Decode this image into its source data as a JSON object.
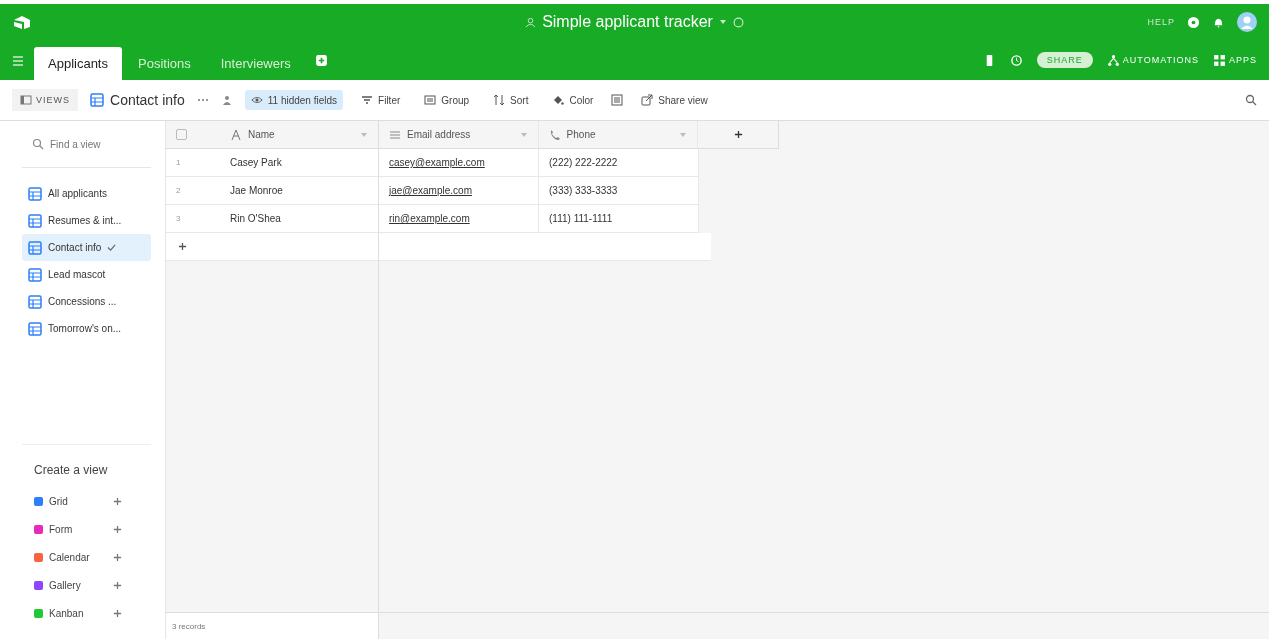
{
  "header": {
    "title": "Simple applicant tracker",
    "help": "HELP"
  },
  "tabs": [
    {
      "label": "Applicants",
      "selected": true
    },
    {
      "label": "Positions",
      "selected": false
    },
    {
      "label": "Interviewers",
      "selected": false
    }
  ],
  "base_actions": {
    "share": "SHARE",
    "automations": "AUTOMATIONS",
    "apps": "APPS"
  },
  "toolbar": {
    "views": "VIEWS",
    "current_view": "Contact info",
    "hidden_fields": "11 hidden fields",
    "filter": "Filter",
    "group": "Group",
    "sort": "Sort",
    "color_label": "Color",
    "share_view": "Share view"
  },
  "sidebar": {
    "search": {
      "placeholder": "Find a view"
    },
    "items": [
      {
        "label": "All applicants",
        "selected": false
      },
      {
        "label": "Resumes & int...",
        "selected": false
      },
      {
        "label": "Contact info",
        "selected": true
      },
      {
        "label": "Lead mascot",
        "selected": false
      },
      {
        "label": "Concessions ...",
        "selected": false
      },
      {
        "label": "Tomorrow's on...",
        "selected": false
      }
    ],
    "create_title": "Create a view",
    "create_items": [
      {
        "label": "Grid",
        "color": "#2d7ff9"
      },
      {
        "label": "Form",
        "color": "#e929ba"
      },
      {
        "label": "Calendar",
        "color": "#f8643e"
      },
      {
        "label": "Gallery",
        "color": "#8b46ff"
      },
      {
        "label": "Kanban",
        "color": "#20c933"
      }
    ]
  },
  "table": {
    "select_all": {
      "checked": false
    },
    "columns": [
      {
        "label": "Name",
        "kind": "text"
      },
      {
        "label": "Email address",
        "kind": "email"
      },
      {
        "label": "Phone",
        "kind": "phone"
      }
    ],
    "rows": [
      {
        "number": "1",
        "cells": [
          "Casey Park",
          "casey@example.com",
          "(222) 222-2222"
        ]
      },
      {
        "number": "2",
        "cells": [
          "Jae Monroe",
          "jae@example.com",
          "(333) 333-3333"
        ]
      },
      {
        "number": "3",
        "cells": [
          "Rin O'Shea",
          "rin@example.com",
          "(111) 111-1111"
        ]
      }
    ],
    "records": "3 records"
  }
}
